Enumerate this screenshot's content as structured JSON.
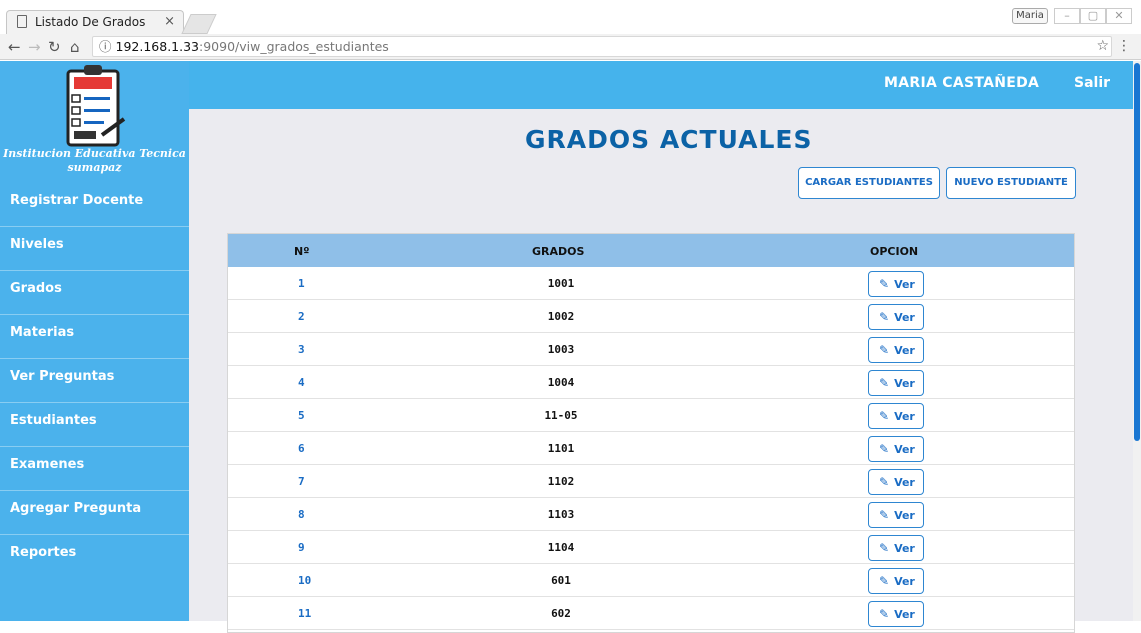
{
  "browser": {
    "tab_title": "Listado De Grados",
    "tab_close": "×",
    "user_badge": "Maria",
    "url_host": "192.168.1.33",
    "url_rest": ":9090/viw_grados_estudiantes"
  },
  "header": {
    "user_name": "MARIA CASTAÑEDA",
    "logout": "Salir"
  },
  "sidebar": {
    "school_name_line1": "Institucion Educativa Tecnica",
    "school_name_line2": "sumapaz",
    "items": [
      {
        "label": "Registrar Docente"
      },
      {
        "label": "Niveles"
      },
      {
        "label": "Grados"
      },
      {
        "label": "Materias"
      },
      {
        "label": "Ver Preguntas"
      },
      {
        "label": "Estudiantes"
      },
      {
        "label": "Examenes"
      },
      {
        "label": "Agregar Pregunta"
      },
      {
        "label": "Reportes"
      }
    ]
  },
  "main": {
    "title": "GRADOS ACTUALES",
    "btn_load": "CARGAR ESTUDIANTES",
    "btn_new": "NUEVO ESTUDIANTE"
  },
  "table": {
    "headers": {
      "num": "Nº",
      "grade": "GRADOS",
      "option": "OPCION"
    },
    "action_label": "Ver",
    "rows": [
      {
        "num": "1",
        "grade": "1001"
      },
      {
        "num": "2",
        "grade": "1002"
      },
      {
        "num": "3",
        "grade": "1003"
      },
      {
        "num": "4",
        "grade": "1004"
      },
      {
        "num": "5",
        "grade": "11-05"
      },
      {
        "num": "6",
        "grade": "1101"
      },
      {
        "num": "7",
        "grade": "1102"
      },
      {
        "num": "8",
        "grade": "1103"
      },
      {
        "num": "9",
        "grade": "1104"
      },
      {
        "num": "10",
        "grade": "601"
      },
      {
        "num": "11",
        "grade": "602"
      }
    ]
  },
  "colors": {
    "header": "#45b3ec",
    "sidebar": "#4bb2ec",
    "title": "#0b62a6",
    "accent": "#1a6cc4"
  }
}
